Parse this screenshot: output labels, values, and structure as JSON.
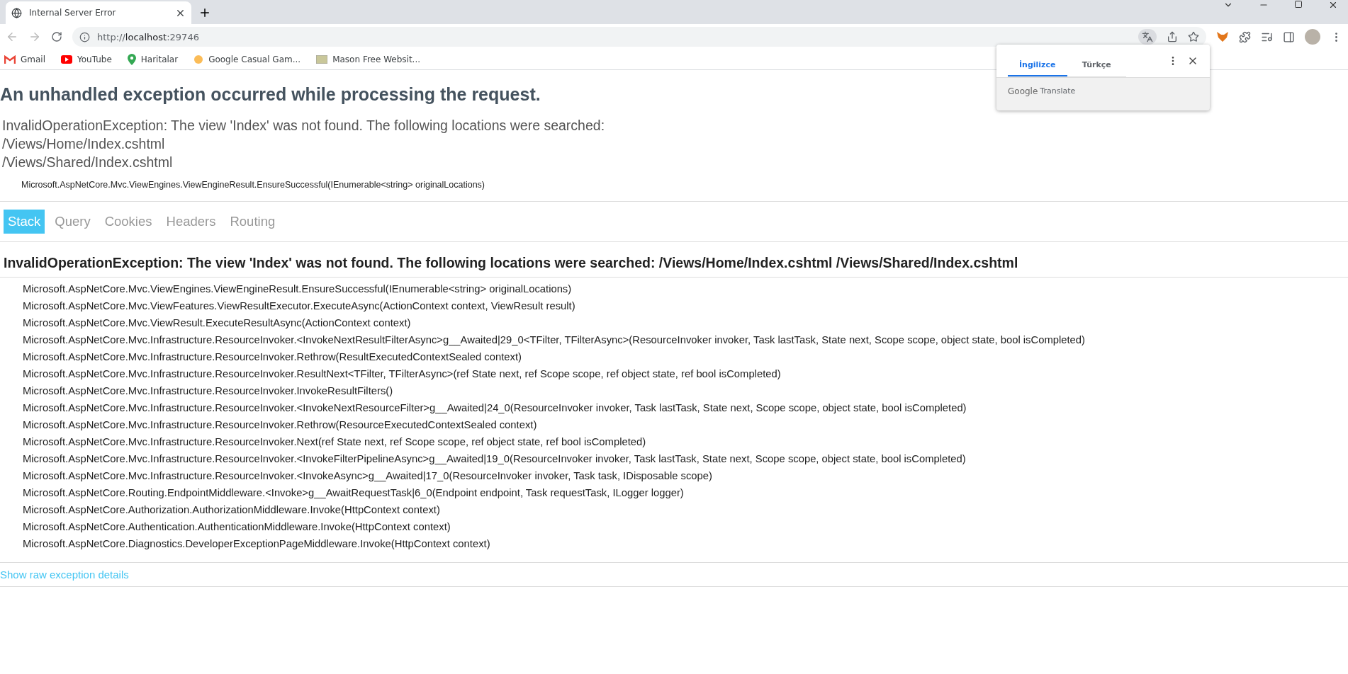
{
  "browser": {
    "tab": {
      "title": "Internal Server Error",
      "selected": true
    },
    "address": {
      "scheme": "http://",
      "host": "localhost",
      "port": ":29746"
    },
    "bookmarks": [
      {
        "kind": "gmail",
        "label": "Gmail"
      },
      {
        "kind": "youtube",
        "label": "YouTube"
      },
      {
        "kind": "maps",
        "label": "Haritalar"
      },
      {
        "kind": "dot",
        "label": "Google Casual Gam..."
      },
      {
        "kind": "css",
        "label": "Mason Free Websit..."
      }
    ]
  },
  "translate_popup": {
    "tabs": [
      {
        "label": "İngilizce",
        "selected": true
      },
      {
        "label": "Türkçe",
        "selected": false
      }
    ],
    "brand": "Google",
    "product": "Translate"
  },
  "page": {
    "title": "An unhandled exception occurred while processing the request.",
    "message_lines": [
      "InvalidOperationException: The view 'Index' was not found. The following locations were searched:",
      "/Views/Home/Index.cshtml",
      "/Views/Shared/Index.cshtml"
    ],
    "location": "Microsoft.AspNetCore.Mvc.ViewEngines.ViewEngineResult.EnsureSuccessful(IEnumerable<string> originalLocations)",
    "tabs": [
      {
        "label": "Stack",
        "selected": true
      },
      {
        "label": "Query",
        "selected": false
      },
      {
        "label": "Cookies",
        "selected": false
      },
      {
        "label": "Headers",
        "selected": false
      },
      {
        "label": "Routing",
        "selected": false
      }
    ],
    "stack_title": "InvalidOperationException: The view 'Index' was not found. The following locations were searched: /Views/Home/Index.cshtml /Views/Shared/Index.cshtml",
    "stack_frames": [
      "Microsoft.AspNetCore.Mvc.ViewEngines.ViewEngineResult.EnsureSuccessful(IEnumerable<string> originalLocations)",
      "Microsoft.AspNetCore.Mvc.ViewFeatures.ViewResultExecutor.ExecuteAsync(ActionContext context, ViewResult result)",
      "Microsoft.AspNetCore.Mvc.ViewResult.ExecuteResultAsync(ActionContext context)",
      "Microsoft.AspNetCore.Mvc.Infrastructure.ResourceInvoker.<InvokeNextResultFilterAsync>g__Awaited|29_0<TFilter, TFilterAsync>(ResourceInvoker invoker, Task lastTask, State next, Scope scope, object state, bool isCompleted)",
      "Microsoft.AspNetCore.Mvc.Infrastructure.ResourceInvoker.Rethrow(ResultExecutedContextSealed context)",
      "Microsoft.AspNetCore.Mvc.Infrastructure.ResourceInvoker.ResultNext<TFilter, TFilterAsync>(ref State next, ref Scope scope, ref object state, ref bool isCompleted)",
      "Microsoft.AspNetCore.Mvc.Infrastructure.ResourceInvoker.InvokeResultFilters()",
      "Microsoft.AspNetCore.Mvc.Infrastructure.ResourceInvoker.<InvokeNextResourceFilter>g__Awaited|24_0(ResourceInvoker invoker, Task lastTask, State next, Scope scope, object state, bool isCompleted)",
      "Microsoft.AspNetCore.Mvc.Infrastructure.ResourceInvoker.Rethrow(ResourceExecutedContextSealed context)",
      "Microsoft.AspNetCore.Mvc.Infrastructure.ResourceInvoker.Next(ref State next, ref Scope scope, ref object state, ref bool isCompleted)",
      "Microsoft.AspNetCore.Mvc.Infrastructure.ResourceInvoker.<InvokeFilterPipelineAsync>g__Awaited|19_0(ResourceInvoker invoker, Task lastTask, State next, Scope scope, object state, bool isCompleted)",
      "Microsoft.AspNetCore.Mvc.Infrastructure.ResourceInvoker.<InvokeAsync>g__Awaited|17_0(ResourceInvoker invoker, Task task, IDisposable scope)",
      "Microsoft.AspNetCore.Routing.EndpointMiddleware.<Invoke>g__AwaitRequestTask|6_0(Endpoint endpoint, Task requestTask, ILogger logger)",
      "Microsoft.AspNetCore.Authorization.AuthorizationMiddleware.Invoke(HttpContext context)",
      "Microsoft.AspNetCore.Authentication.AuthenticationMiddleware.Invoke(HttpContext context)",
      "Microsoft.AspNetCore.Diagnostics.DeveloperExceptionPageMiddleware.Invoke(HttpContext context)"
    ],
    "raw_link": "Show raw exception details"
  }
}
